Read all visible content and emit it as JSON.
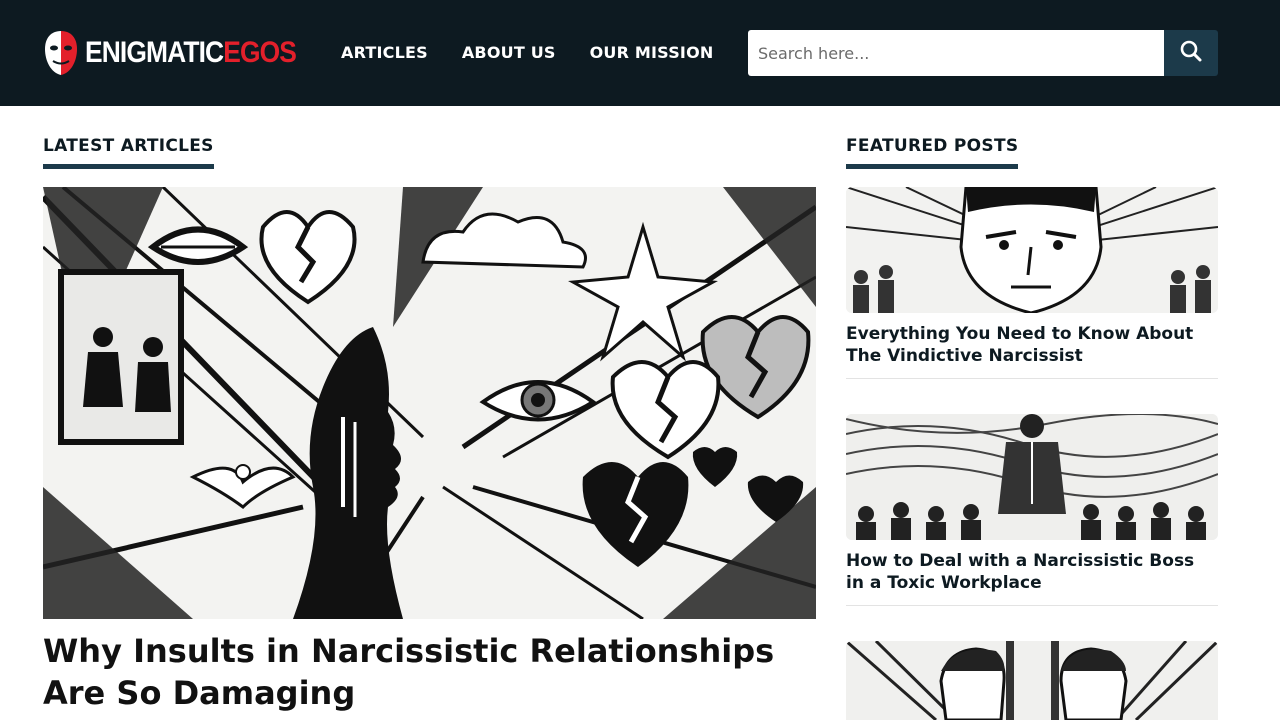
{
  "brand": {
    "name_part1": "ENIGMATIC",
    "name_part2": "EGOS",
    "accent_color": "#e3202b",
    "header_bg": "#0d1a21"
  },
  "nav": {
    "items": [
      {
        "label": "ARTICLES"
      },
      {
        "label": "ABOUT US"
      },
      {
        "label": "OUR MISSION"
      }
    ]
  },
  "search": {
    "placeholder": "Search here...",
    "value": "",
    "icon": "search-icon"
  },
  "latest": {
    "heading": "LATEST ARTICLES",
    "article": {
      "title": "Why Insults in Narcissistic Relationships Are So Damaging",
      "image": "black-and-white-illustration-broken-hearts-eye-silhouette"
    }
  },
  "featured": {
    "heading": "FEATURED POSTS",
    "posts": [
      {
        "title": "Everything You Need to Know About The Vindictive Narcissist",
        "image": "intense-man-face-illustration"
      },
      {
        "title": "How to Deal with a Narcissistic Boss in a Toxic Workplace",
        "image": "suited-man-crowd-illustration"
      },
      {
        "title": "",
        "image": "two-men-facing-illustration"
      }
    ]
  }
}
